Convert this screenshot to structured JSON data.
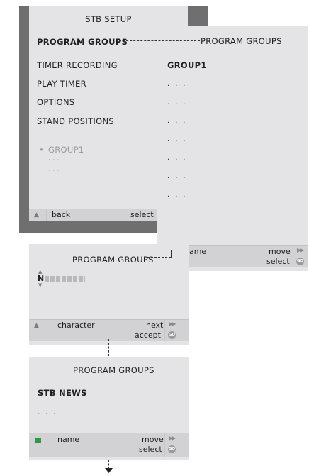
{
  "setup_menu": {
    "title": "STB SETUP",
    "items": [
      "PROGRAM GROUPS",
      "TIMER RECORDING",
      "PLAY TIMER",
      "OPTIONS",
      "STAND POSITIONS"
    ],
    "group_bullet": "•",
    "group_label": "GROUP1",
    "group_placeholders": [
      "· · ·",
      "· · ·"
    ],
    "bar": {
      "back_symbol": "▲",
      "back_label": "back",
      "select_label": "select"
    }
  },
  "groups_panel": {
    "title": "PROGRAM GROUPS",
    "group": "GROUP1",
    "placeholders": [
      ". . .",
      ". . .",
      ". . .",
      ". . .",
      ". . .",
      ". . .",
      ". . ."
    ],
    "bar": {
      "name_label": "name",
      "move_label": "move",
      "select_label": "select",
      "ff_icon": "▶▶",
      "go_label": "GO"
    }
  },
  "naming_panel": {
    "title": "PROGRAM GROUPS",
    "char_up": "▲",
    "current_char": "N",
    "char_down": "▼",
    "bar": {
      "back_symbol": "▲",
      "character_label": "character",
      "next_label": "next",
      "accept_label": "accept",
      "ff_icon": "▶▶",
      "go_label": "GO"
    }
  },
  "result_panel": {
    "title": "PROGRAM GROUPS",
    "group_name": "STB  NEWS",
    "placeholder": ". . .",
    "bar": {
      "name_label": "name",
      "move_label": "move",
      "select_label": "select",
      "ff_icon": "▶▶",
      "go_label": "GO"
    }
  },
  "colors": {
    "panel": "#e4e4e6",
    "bar": "#d2d2d4",
    "dark_backdrop": "#6f6f6f",
    "green_key": "#2a9a45"
  }
}
